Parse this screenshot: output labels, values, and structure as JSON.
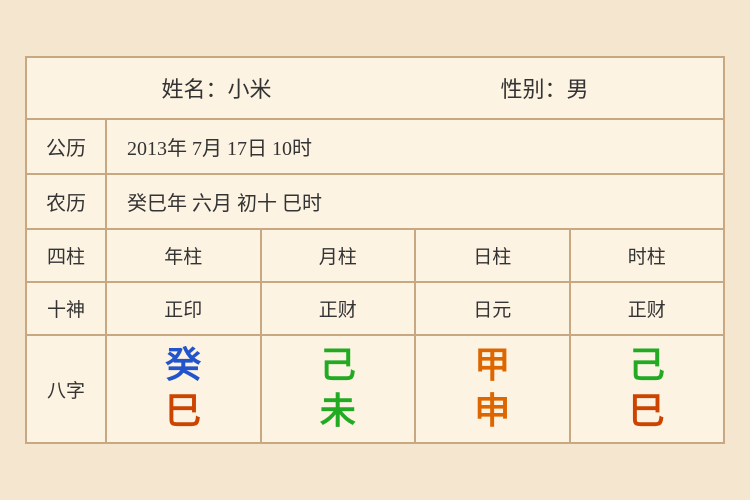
{
  "header": {
    "name_label": "姓名：小米",
    "gender_label": "性别：男"
  },
  "solar_row": {
    "label": "公历",
    "content": "2013年 7月 17日 10时"
  },
  "lunar_row": {
    "label": "农历",
    "content": "癸巳年 六月 初十 巳时"
  },
  "sijhu_header": {
    "label": "四柱",
    "cols": [
      "年柱",
      "月柱",
      "日柱",
      "时柱"
    ]
  },
  "shishen_row": {
    "label": "十神",
    "values": [
      "正印",
      "正财",
      "日元",
      "正财"
    ]
  },
  "bazi_row": {
    "label": "八字",
    "cells": [
      {
        "top": "癸",
        "top_color": "color-blue",
        "bottom": "巳",
        "bottom_color": "color-red-brown"
      },
      {
        "top": "己",
        "top_color": "color-green",
        "bottom": "未",
        "bottom_color": "color-green"
      },
      {
        "top": "甲",
        "top_color": "color-orange",
        "bottom": "申",
        "bottom_color": "color-orange"
      },
      {
        "top": "己",
        "top_color": "color-green2",
        "bottom": "巳",
        "bottom_color": "color-red-brown"
      }
    ]
  }
}
